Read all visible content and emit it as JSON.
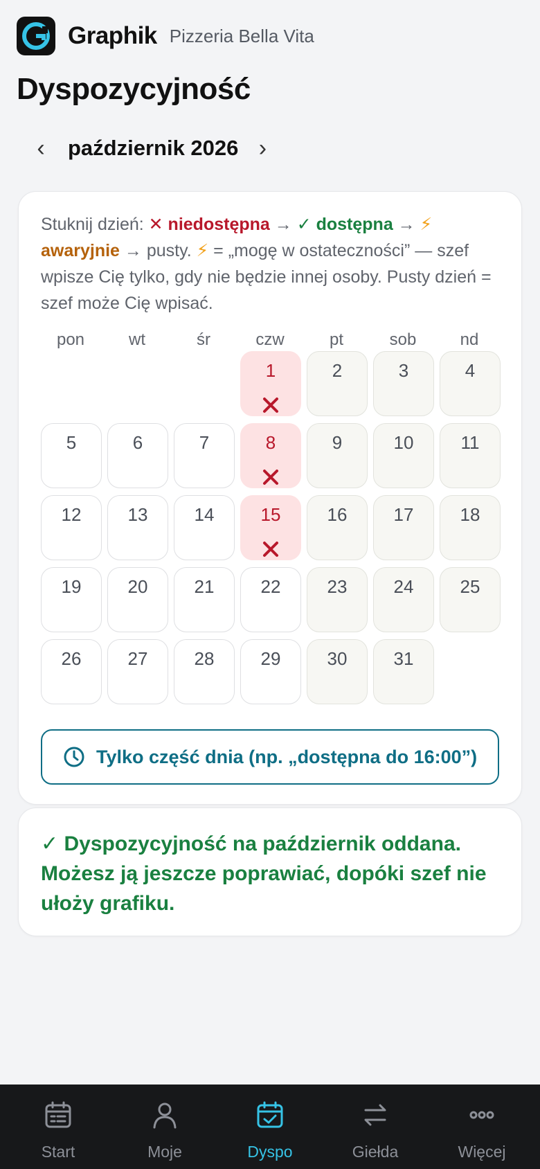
{
  "header": {
    "brand": "Graphik",
    "organization": "Pizzeria Bella Vita"
  },
  "page_title": "Dyspozycyjność",
  "month_nav": {
    "prev": "‹",
    "label": "październik 2026",
    "next": "›"
  },
  "hint": {
    "prefix": "Stuknij dzień: ",
    "unavailable_symbol": "✕",
    "unavailable": "niedostępna",
    "arrow": " → ",
    "available_symbol": "✓",
    "available": "dostępna",
    "emergency_symbol": "⚡",
    "emergency": "awaryjnie",
    "empty": "pusty. ",
    "explanation": " = „mogę w ostateczności” — szef wpisze Cię tylko, gdy nie będzie innej osoby. Pusty dzień = szef może Cię wpisać."
  },
  "weekdays": [
    "pon",
    "wt",
    "śr",
    "czw",
    "pt",
    "sob",
    "nd"
  ],
  "days": [
    {
      "n": "1",
      "status": "unavailable"
    },
    {
      "n": "2",
      "status": "empty"
    },
    {
      "n": "3",
      "status": "empty"
    },
    {
      "n": "4",
      "status": "empty"
    },
    {
      "n": "5",
      "status": "empty"
    },
    {
      "n": "6",
      "status": "empty"
    },
    {
      "n": "7",
      "status": "empty"
    },
    {
      "n": "8",
      "status": "unavailable"
    },
    {
      "n": "9",
      "status": "empty"
    },
    {
      "n": "10",
      "status": "empty"
    },
    {
      "n": "11",
      "status": "empty"
    },
    {
      "n": "12",
      "status": "empty"
    },
    {
      "n": "13",
      "status": "empty"
    },
    {
      "n": "14",
      "status": "empty"
    },
    {
      "n": "15",
      "status": "unavailable"
    },
    {
      "n": "16",
      "status": "empty"
    },
    {
      "n": "17",
      "status": "empty"
    },
    {
      "n": "18",
      "status": "empty"
    },
    {
      "n": "19",
      "status": "empty"
    },
    {
      "n": "20",
      "status": "empty"
    },
    {
      "n": "21",
      "status": "empty"
    },
    {
      "n": "22",
      "status": "empty"
    },
    {
      "n": "23",
      "status": "empty"
    },
    {
      "n": "24",
      "status": "empty"
    },
    {
      "n": "25",
      "status": "empty"
    },
    {
      "n": "26",
      "status": "empty"
    },
    {
      "n": "27",
      "status": "empty"
    },
    {
      "n": "28",
      "status": "empty"
    },
    {
      "n": "29",
      "status": "empty"
    },
    {
      "n": "30",
      "status": "empty"
    },
    {
      "n": "31",
      "status": "empty"
    }
  ],
  "partial_day_button": "Tylko część dnia (np. „dostępna do 16:00”)",
  "status_message": "✓ Dyspozycyjność na październik oddana. Możesz ją jeszcze poprawiać, dopóki szef nie ułoży grafiku.",
  "tabs": [
    {
      "label": "Start",
      "icon": "calendar-list-icon",
      "active": false
    },
    {
      "label": "Moje",
      "icon": "user-icon",
      "active": false
    },
    {
      "label": "Dyspo",
      "icon": "calendar-check-icon",
      "active": true
    },
    {
      "label": "Giełda",
      "icon": "swap-arrows-icon",
      "active": false
    },
    {
      "label": "Więcej",
      "icon": "more-dots-icon",
      "active": false
    }
  ],
  "colors": {
    "accent": "#36c3e6",
    "button": "#0f6e85",
    "unavailable": "#b8182b",
    "available": "#1a8040",
    "emergency": "#b5620b"
  }
}
